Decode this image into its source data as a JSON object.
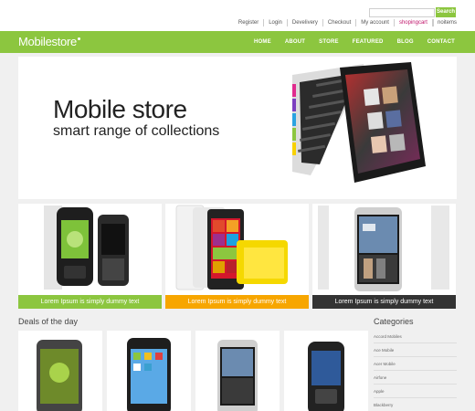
{
  "header": {
    "search_placeholder": "",
    "search_button": "Search",
    "links": [
      "Register",
      "Login",
      "Develivery",
      "Checkout",
      "My account"
    ],
    "cart_label": "shopingcart",
    "cart_count": "noitems"
  },
  "nav": {
    "logo_mobile": "Mobile",
    "logo_store": "store",
    "items": [
      "HOME",
      "ABOUT",
      "STORE",
      "FEATURED",
      "BLOG",
      "CONTACT"
    ]
  },
  "hero": {
    "title": "Mobile store",
    "subtitle": "smart range of collections"
  },
  "tiles": [
    {
      "caption": "Lorem Ipsum is simply dummy text",
      "color": "#8cc63f"
    },
    {
      "caption": "Lorem Ipsum is simply dummy text",
      "color": "#f7a600"
    },
    {
      "caption": "Lorem Ipsum is simply dummy text",
      "color": "#333333"
    }
  ],
  "deals": {
    "title": "Deals of the day"
  },
  "categories": {
    "title": "Categories",
    "items": [
      "Accord Mobiles",
      "Ace Mobile",
      "Acer Mobile",
      "Airfone",
      "Apple",
      "Blackberry"
    ]
  },
  "colors": {
    "accent": "#8cc63f",
    "orange": "#f7a600",
    "dark": "#333333",
    "cart": "#c0156b"
  }
}
